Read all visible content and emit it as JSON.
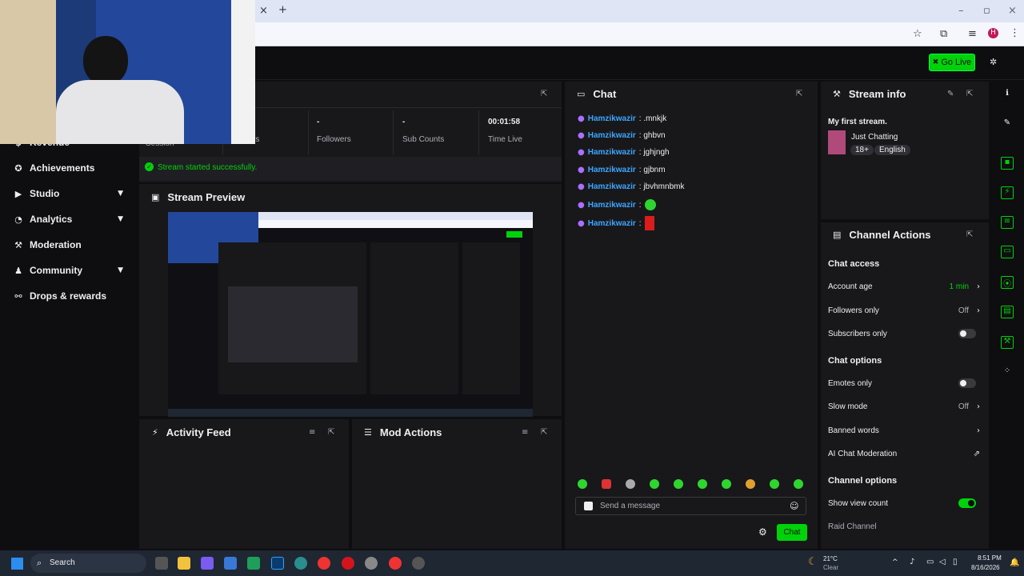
{
  "browser": {
    "new_tab": "+",
    "close_tab": "×",
    "profile_initial": "H"
  },
  "header": {
    "go_live_label": "Go Live"
  },
  "sidebar": {
    "items": [
      {
        "label": "Revenue",
        "icon": "revenue-icon"
      },
      {
        "label": "Achievements",
        "icon": "achievement-icon"
      },
      {
        "label": "Studio",
        "icon": "studio-icon"
      },
      {
        "label": "Analytics",
        "icon": "analytics-icon"
      },
      {
        "label": "Moderation",
        "icon": "wrench-icon"
      },
      {
        "label": "Community",
        "icon": "community-icon"
      },
      {
        "label": "Drops & rewards",
        "icon": "drops-icon"
      }
    ]
  },
  "stats": {
    "session_label": "Session",
    "viewers_label": "rs",
    "followers_value": "-",
    "followers_label": "Followers",
    "subs_value": "-",
    "subs_label": "Sub Counts",
    "time_value": "00:01:58",
    "time_label": "Time Live"
  },
  "notice": "Stream started successfully.",
  "stream_preview": {
    "title": "Stream Preview"
  },
  "activity_feed": {
    "title": "Activity Feed"
  },
  "mod_actions": {
    "title": "Mod Actions"
  },
  "chat": {
    "title": "Chat",
    "messages": [
      {
        "user": "Hamzikwazir",
        "text": ".mnkjk"
      },
      {
        "user": "Hamzikwazir",
        "text": "ghbvn"
      },
      {
        "user": "Hamzikwazir",
        "text": "jghjngh"
      },
      {
        "user": "Hamzikwazir",
        "text": "gjbnm"
      },
      {
        "user": "Hamzikwazir",
        "text": "jbvhmnbmk"
      },
      {
        "user": "Hamzikwazir",
        "text": ""
      },
      {
        "user": "Hamzikwazir",
        "text": ""
      }
    ],
    "input_placeholder": "Send a message",
    "send_label": "Chat"
  },
  "stream_info": {
    "title": "Stream info",
    "stream_title": "My first stream.",
    "category": "Just Chatting",
    "tags": [
      "18+",
      "English"
    ]
  },
  "channel_actions": {
    "title": "Channel Actions",
    "chat_access_heading": "Chat access",
    "account_age_label": "Account age",
    "account_age_value": "1 min",
    "followers_only_label": "Followers only",
    "followers_only_value": "Off",
    "subscribers_only_label": "Subscribers only",
    "subscribers_only_on": false,
    "chat_options_heading": "Chat options",
    "emotes_only_label": "Emotes only",
    "emotes_only_on": false,
    "slow_mode_label": "Slow mode",
    "slow_mode_value": "Off",
    "banned_words_label": "Banned words",
    "ai_moderation_label": "AI Chat Moderation",
    "channel_options_heading": "Channel options",
    "show_view_count_label": "Show view count",
    "show_view_count_on": true,
    "raid_channel_label": "Raid Channel"
  },
  "taskbar": {
    "search_label": "Search",
    "weather_temp": "21°C",
    "weather_desc": "Clear",
    "time": "8:51 PM",
    "date": "8/16/2026"
  },
  "colors": {
    "accent_green": "#00d20a",
    "chat_username": "#3ea6ff",
    "badge_purple": "#a970ff",
    "panel_bg": "#18181b",
    "page_bg": "#0e0e10"
  }
}
